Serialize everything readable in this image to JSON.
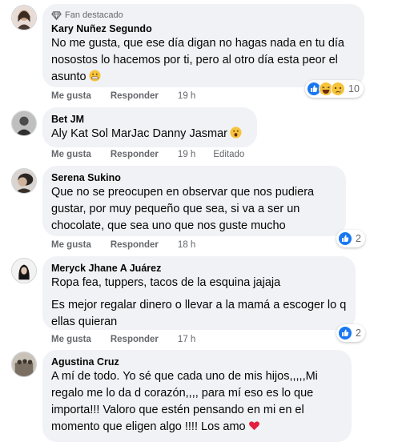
{
  "comments": [
    {
      "badge": "Fan destacado",
      "author": "Kary Nuñez Segundo",
      "paragraphs": [
        "No me gusta, que ese día digan no hagas nada en tu día nosostos lo hacemos por ti, pero al otro día esta peor el asunto"
      ],
      "like_label": "Me gusta",
      "reply_label": "Responder",
      "time": "19 h",
      "reaction_count": "10",
      "reaction_icons": [
        "like-icon",
        "haha-icon",
        "sad-icon"
      ]
    },
    {
      "author": "Bet JM",
      "paragraphs": [
        "Aly Kat Sol MarJac Danny Jasmar"
      ],
      "like_label": "Me gusta",
      "reply_label": "Responder",
      "time": "19 h",
      "edited": "Editado"
    },
    {
      "author": "Serena Sukino",
      "paragraphs": [
        "Que no se preocupen en observar que nos pudiera gustar, por muy pequeño que sea, si va a ser un chocolate, que sea uno que nos guste mucho"
      ],
      "like_label": "Me gusta",
      "reply_label": "Responder",
      "time": "18 h",
      "reaction_count": "2",
      "reaction_icons": [
        "like-icon"
      ]
    },
    {
      "author": "Meryck Jhane A Juárez",
      "paragraphs": [
        "Ropa fea, tuppers, tacos de la esquina jajaja",
        "Es mejor regalar dinero o llevar a la mamá a escoger lo q ellas quieran"
      ],
      "like_label": "Me gusta",
      "reply_label": "Responder",
      "time": "17 h",
      "reaction_count": "2",
      "reaction_icons": [
        "like-icon"
      ]
    },
    {
      "author": "Agustina Cruz",
      "paragraphs": [
        "A mí de todo. Yo sé que cada uno de mis hijos,,,,,Mi regalo me lo da d corazón,,,, para mí eso es lo que importa!!! Valoro que estén pensando en mi en el momento que eligen algo !!!! Los amo"
      ],
      "emoji": "red-heart-icon"
    }
  ],
  "colors": {
    "bubble": "#f0f2f5",
    "like_blue": "#1877f2",
    "secondary_text": "#65676b",
    "heart_red": "#e41e3f"
  }
}
